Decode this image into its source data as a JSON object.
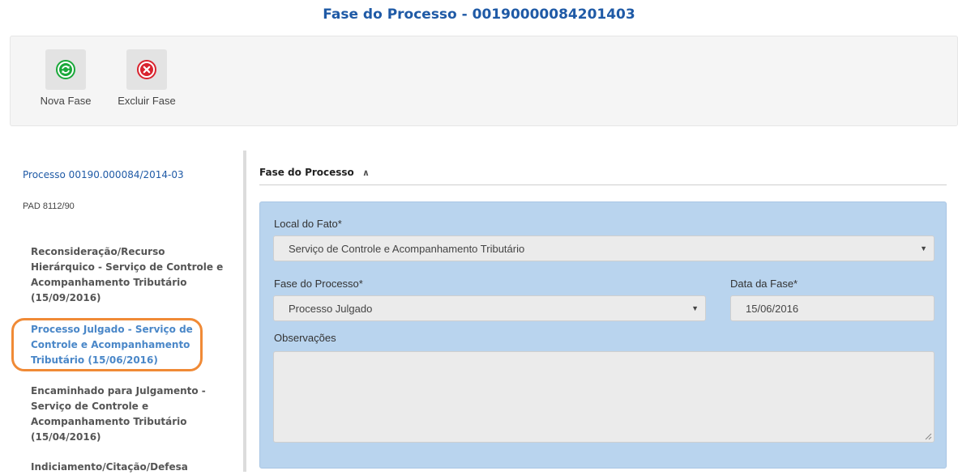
{
  "page": {
    "title": "Fase do Processo - 00190000084201403"
  },
  "toolbar": {
    "nova_fase_label": "Nova Fase",
    "excluir_fase_label": "Excluir Fase",
    "nova_fase_icon": "refresh-icon",
    "excluir_fase_icon": "close-circle-icon",
    "nova_color": "#1aa83a",
    "excluir_color": "#d9232e"
  },
  "sidebar": {
    "process_title": "Processo 00190.000084/2014-03",
    "process_type": "PAD 8112/90",
    "phases": [
      {
        "label": "Reconsideração/Recurso Hierárquico - Serviço de Controle e Acompanhamento Tributário (15/09/2016)"
      },
      {
        "label": "Processo Julgado - Serviço de Controle e Acompanhamento Tributário (15/06/2016)"
      },
      {
        "label": "Encaminhado para Julgamento - Serviço de Controle e Acompanhamento Tributário (15/04/2016)"
      },
      {
        "label": "Indiciamento/Citação/Defesa"
      }
    ],
    "highlight_color": "#f08a36"
  },
  "section": {
    "title": "Fase do Processo",
    "collapse_icon": "chevron-double-up-icon"
  },
  "form": {
    "local_label": "Local do Fato*",
    "local_value": "Serviço de Controle e Acompanhamento Tributário",
    "fase_label": "Fase do Processo*",
    "fase_value": "Processo Julgado",
    "data_label": "Data da Fase*",
    "data_value": "15/06/2016",
    "obs_label": "Observações",
    "obs_value": "",
    "panel_color": "#b9d4ee"
  }
}
